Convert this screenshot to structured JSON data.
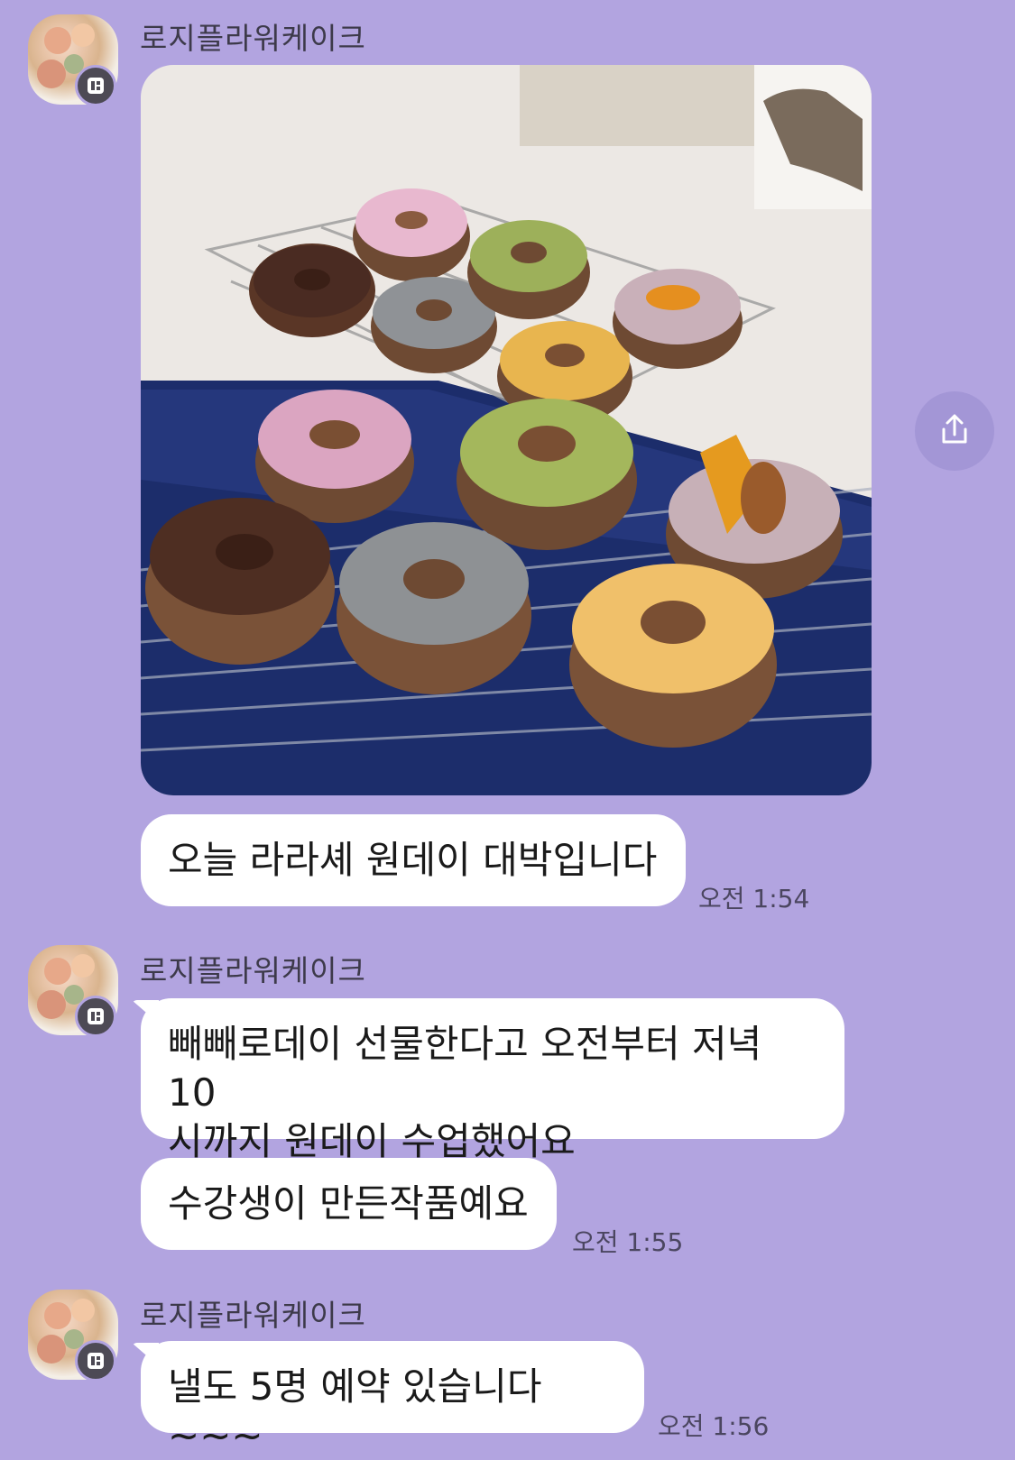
{
  "messages": [
    {
      "sender": "로지플라워케이크",
      "items": [
        {
          "type": "image",
          "icon": "donut-photo"
        },
        {
          "type": "text",
          "text": "오늘 라라셰 원데이 대박입니다",
          "time": "오전 1:54"
        }
      ]
    },
    {
      "sender": "로지플라워케이크",
      "items": [
        {
          "type": "text",
          "text": "빼빼로데이 선물한다고 오전부터 저녁 10\n시까지 원데이 수업했어요"
        },
        {
          "type": "text",
          "text": "수강생이 만든작품예요",
          "time": "오전 1:55"
        }
      ]
    },
    {
      "sender": "로지플라워케이크",
      "items": [
        {
          "type": "text",
          "text": "낼도 5명 예약 있습니다~~~",
          "time": "오전 1:56"
        }
      ]
    }
  ],
  "share_icon": "share-icon",
  "colors": {
    "background": "#b2a4e0",
    "bubble": "#ffffff",
    "badge": "#4d4a55"
  }
}
